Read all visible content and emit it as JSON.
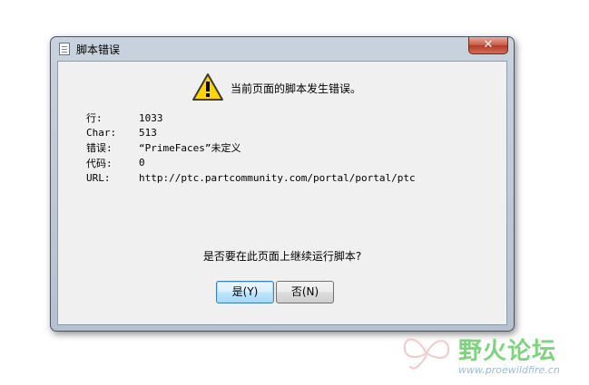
{
  "window": {
    "title": "脚本错误",
    "close_glyph": "✕"
  },
  "message": {
    "headline": "当前页面的脚本发生错误。",
    "icon": "warning-icon",
    "details": [
      {
        "label": "行:",
        "value": "1033"
      },
      {
        "label": "Char:",
        "value": "513"
      },
      {
        "label": "错误:",
        "value": "“PrimeFaces”未定义"
      },
      {
        "label": "代码:",
        "value": "0"
      },
      {
        "label": "URL:",
        "value": "http://ptc.partcommunity.com/portal/portal/ptc"
      }
    ],
    "question": "是否要在此页面上继续运行脚本?"
  },
  "buttons": {
    "yes_label": "是(Y)",
    "no_label": "否(N)"
  },
  "watermark": {
    "logo_text": "野火论坛",
    "url": "www.proewildfire.cn"
  },
  "colors": {
    "warning_fill": "#ffd400",
    "close_red": "#c75a45"
  }
}
